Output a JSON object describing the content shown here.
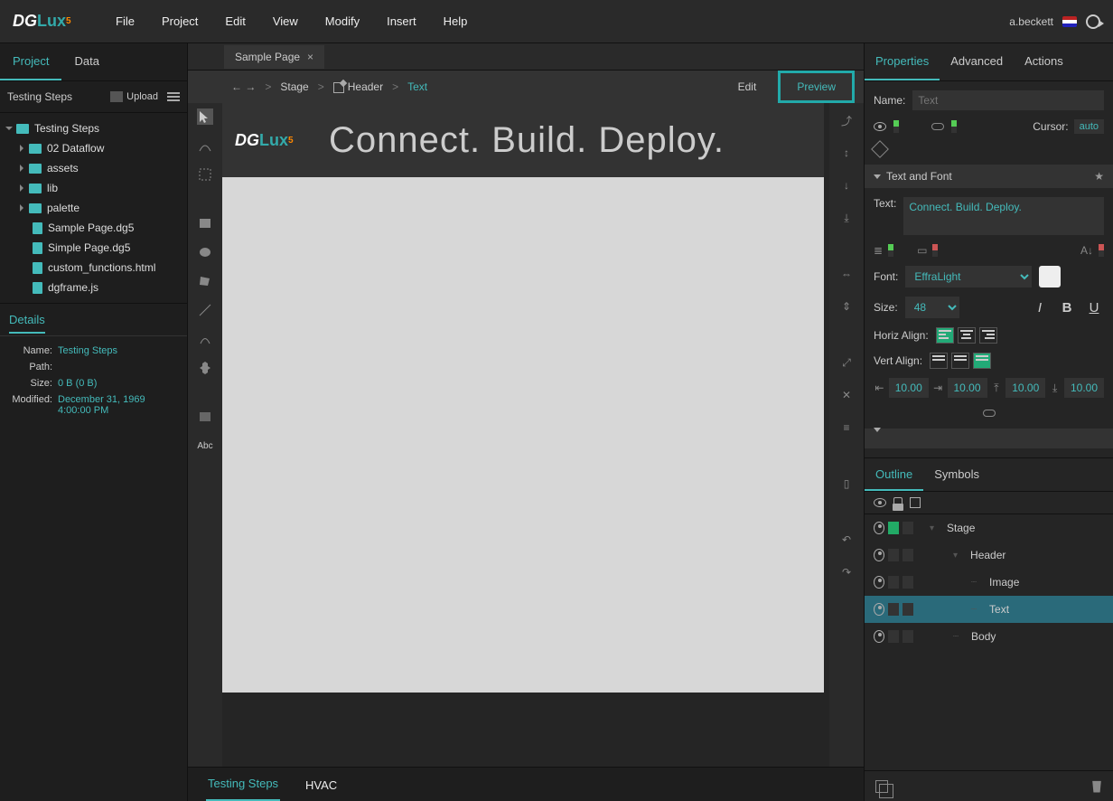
{
  "menubar": {
    "items": [
      "File",
      "Project",
      "Edit",
      "View",
      "Modify",
      "Insert",
      "Help"
    ],
    "user": "a.beckett"
  },
  "left": {
    "tabs": [
      "Project",
      "Data"
    ],
    "header_title": "Testing Steps",
    "upload_label": "Upload",
    "tree_root": "Testing Steps",
    "folders": [
      "02 Dataflow",
      "assets",
      "lib",
      "palette"
    ],
    "files": [
      "Sample Page.dg5",
      "Simple Page.dg5",
      "custom_functions.html",
      "dgframe.js"
    ]
  },
  "details": {
    "title": "Details",
    "name_lbl": "Name:",
    "name_val": "Testing Steps",
    "path_lbl": "Path:",
    "path_val": "",
    "size_lbl": "Size:",
    "size_val": "0 B (0 B)",
    "mod_lbl": "Modified:",
    "mod_val": "December 31, 1969 4:00:00 PM"
  },
  "doc_tab": "Sample Page",
  "breadcrumb": {
    "stage": "Stage",
    "header": "Header",
    "text": "Text",
    "edit": "Edit",
    "preview": "Preview"
  },
  "canvas": {
    "slogan": "Connect. Build. Deploy."
  },
  "bottom_tabs": [
    "Testing Steps",
    "HVAC"
  ],
  "right_tabs": [
    "Properties",
    "Advanced",
    "Actions"
  ],
  "props": {
    "name_lbl": "Name:",
    "name_placeholder": "Text",
    "cursor_lbl": "Cursor:",
    "cursor_val": "auto",
    "section": "Text and Font",
    "text_lbl": "Text:",
    "text_val": "Connect. Build. Deploy.",
    "font_lbl": "Font:",
    "font_val": "EffraLight",
    "size_lbl": "Size:",
    "size_val": "48",
    "horiz_lbl": "Horiz Align:",
    "vert_lbl": "Vert Align:",
    "pad": [
      "10.00",
      "10.00",
      "10.00",
      "10.00"
    ]
  },
  "outline_tabs": [
    "Outline",
    "Symbols"
  ],
  "outline": {
    "items": [
      {
        "label": "Stage",
        "depth": 0
      },
      {
        "label": "Header",
        "depth": 1
      },
      {
        "label": "Image",
        "depth": 2
      },
      {
        "label": "Text",
        "depth": 2,
        "selected": true
      },
      {
        "label": "Body",
        "depth": 1
      }
    ]
  },
  "abc": "Abc"
}
